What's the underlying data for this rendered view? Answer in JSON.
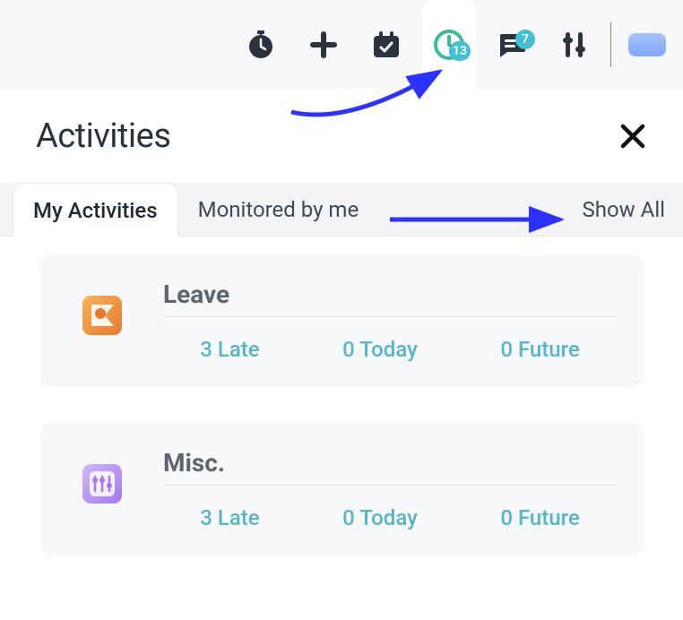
{
  "toolbar": {
    "items": [
      {
        "name": "timer-icon"
      },
      {
        "name": "plus-icon"
      },
      {
        "name": "calendar-check-icon"
      },
      {
        "name": "activity-icon",
        "badge": "13",
        "active": true
      },
      {
        "name": "chat-icon",
        "badge": "7"
      },
      {
        "name": "sliders-icon"
      }
    ]
  },
  "panel": {
    "title": "Activities",
    "tabs": [
      {
        "label": "My Activities",
        "active": true
      },
      {
        "label": "Monitored by me",
        "active": false
      }
    ],
    "show_all_label": "Show All"
  },
  "cards": [
    {
      "title": "Leave",
      "icon_bg": "#eb9a3a",
      "stats": {
        "late": {
          "count": "3",
          "label": "Late"
        },
        "today": {
          "count": "0",
          "label": "Today"
        },
        "future": {
          "count": "0",
          "label": "Future"
        }
      }
    },
    {
      "title": "Misc.",
      "icon_bg": "#b58df5",
      "stats": {
        "late": {
          "count": "3",
          "label": "Late"
        },
        "today": {
          "count": "0",
          "label": "Today"
        },
        "future": {
          "count": "0",
          "label": "Future"
        }
      }
    }
  ]
}
